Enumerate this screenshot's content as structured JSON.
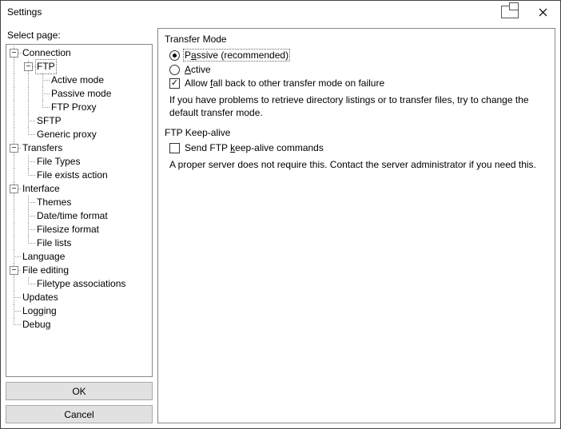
{
  "window": {
    "title": "Settings"
  },
  "left": {
    "select_label": "Select page:",
    "ok": "OK",
    "cancel": "Cancel"
  },
  "tree": {
    "connection": "Connection",
    "ftp": "FTP",
    "active_mode": "Active mode",
    "passive_mode": "Passive mode",
    "ftp_proxy": "FTP Proxy",
    "sftp": "SFTP",
    "generic_proxy": "Generic proxy",
    "transfers": "Transfers",
    "file_types": "File Types",
    "file_exists": "File exists action",
    "interface": "Interface",
    "themes": "Themes",
    "datetime": "Date/time format",
    "filesize": "Filesize format",
    "file_lists": "File lists",
    "language": "Language",
    "file_editing": "File editing",
    "filetype_assoc": "Filetype associations",
    "updates": "Updates",
    "logging": "Logging",
    "debug": "Debug"
  },
  "panel": {
    "transfer_mode_title": "Transfer Mode",
    "passive_pre": "P",
    "passive_u": "a",
    "passive_post": "ssive (recommended)",
    "active_u": "A",
    "active_post": "ctive",
    "fallback_pre": "Allow ",
    "fallback_u": "f",
    "fallback_post": "all back to other transfer mode on failure",
    "transfer_help": "If you have problems to retrieve directory listings or to transfer files, try to change the default transfer mode.",
    "keepalive_title": "FTP Keep-alive",
    "keepalive_pre": "Send FTP ",
    "keepalive_u": "k",
    "keepalive_post": "eep-alive commands",
    "keepalive_help": "A proper server does not require this. Contact the server administrator if you need this."
  }
}
